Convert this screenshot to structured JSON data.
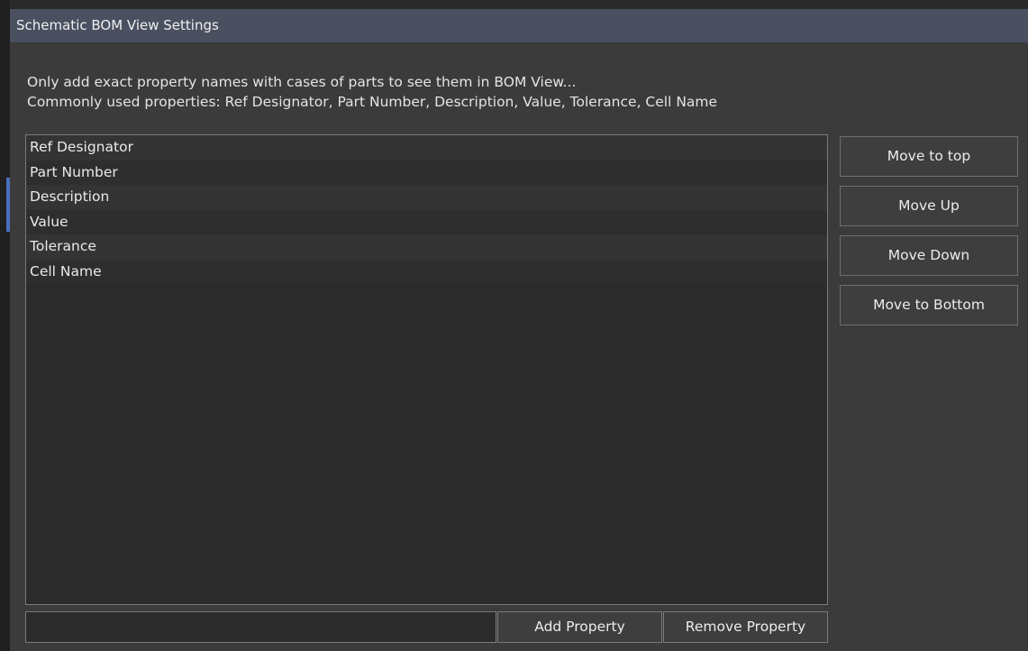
{
  "window": {
    "title": "Schematic BOM View Settings"
  },
  "info": {
    "line1": "Only add exact property names with cases of parts to see them in BOM View...",
    "line2": "Commonly used properties: Ref Designator, Part Number, Description, Value, Tolerance, Cell Name"
  },
  "properties": {
    "items": [
      {
        "label": "Ref Designator"
      },
      {
        "label": "Part Number"
      },
      {
        "label": "Description"
      },
      {
        "label": "Value"
      },
      {
        "label": "Tolerance"
      },
      {
        "label": "Cell Name"
      }
    ]
  },
  "side_buttons": {
    "move_top": "Move to top",
    "move_up": "Move Up",
    "move_down": "Move Down",
    "move_bottom": "Move to Bottom"
  },
  "bottom": {
    "input_value": "",
    "add_label": "Add Property",
    "remove_label": "Remove Property"
  },
  "colors": {
    "titlebar": "#4a5060",
    "background": "#3b3b3b",
    "list_background": "#2b2b2b",
    "accent": "#4a6fbf"
  }
}
